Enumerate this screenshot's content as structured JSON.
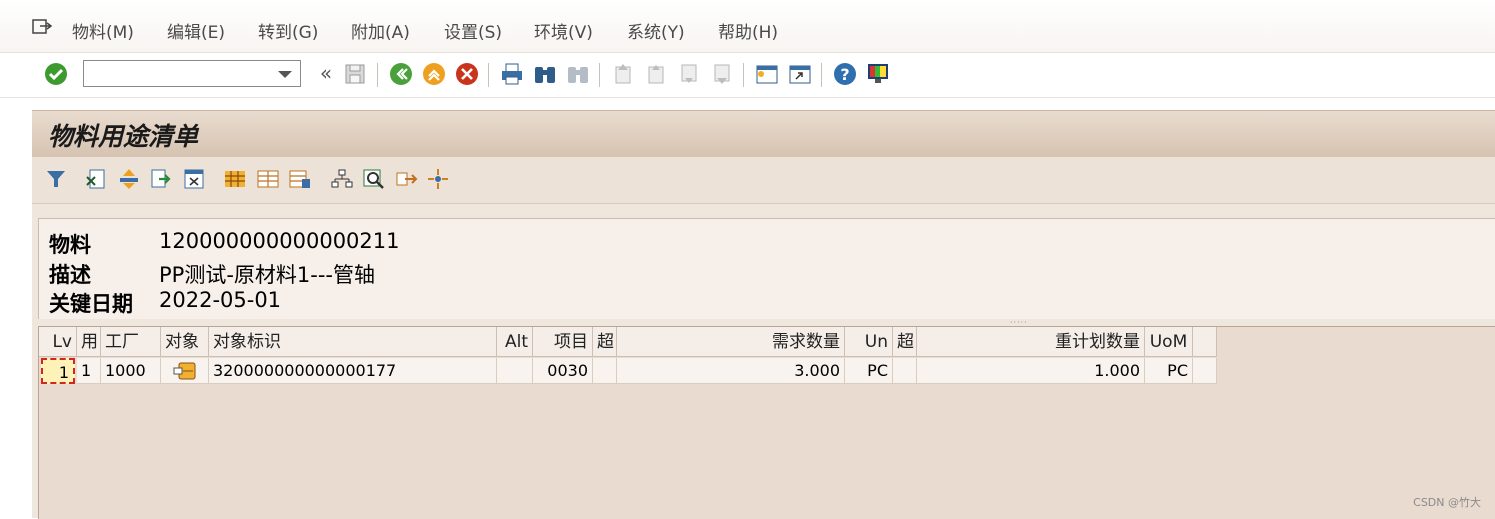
{
  "menu": {
    "items": [
      "物料(M)",
      "编辑(E)",
      "转到(G)",
      "附加(A)",
      "设置(S)",
      "环境(V)",
      "系统(Y)",
      "帮助(H)"
    ]
  },
  "toolbar": {
    "command_value": "",
    "nav_back_glyph": "«"
  },
  "title": "物料用途清单",
  "header": {
    "material_label": "物料",
    "material_value": "120000000000000211",
    "desc_label": "描述",
    "desc_value": "PP测试-原材料1---管轴",
    "date_label": "关键日期",
    "date_value": "2022-05-01"
  },
  "grid": {
    "columns": [
      "Lv",
      "用",
      "工厂",
      "对象",
      "对象标识",
      "Alt",
      "项目",
      "超",
      "需求数量",
      "Un",
      "超",
      "重计划数量",
      "UoM"
    ],
    "rows": [
      {
        "lv": "1",
        "use": "1",
        "plant": "1000",
        "object_icon": "bom-object-icon",
        "object_id": "320000000000000177",
        "alt": "",
        "item": "0030",
        "ex1": "",
        "qty": "3.000",
        "unit": "PC",
        "ex2": "",
        "replan_qty": "1.000",
        "uom": "PC"
      }
    ]
  },
  "watermark": "CSDN @竹大",
  "colors": {
    "title_bg": "#d6c3b1",
    "content_bg": "#efe6de",
    "selected_cell": "#fff2b8",
    "focus_border": "#d2261f"
  }
}
